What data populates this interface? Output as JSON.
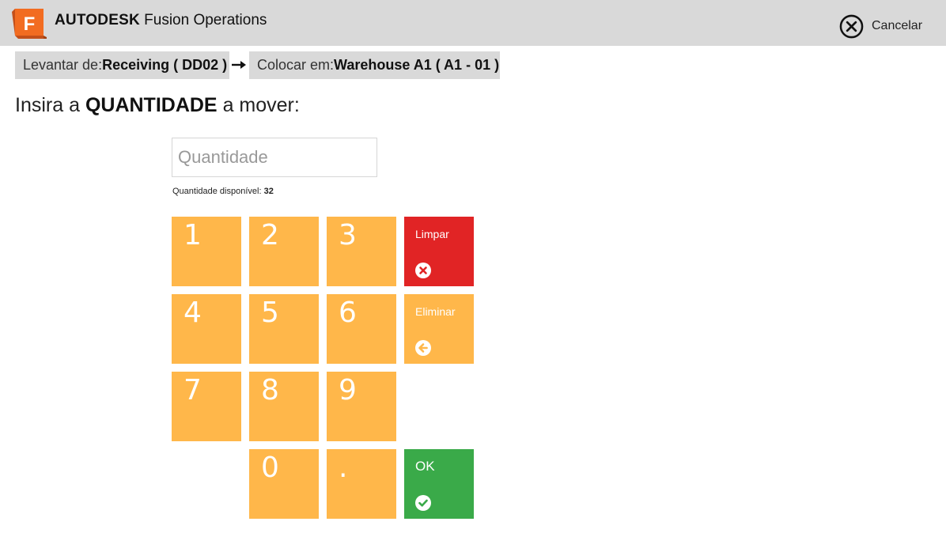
{
  "header": {
    "logo_letter": "F",
    "brand_bold": "AUTODESK",
    "brand_product": "Fusion Operations",
    "cancel_label": "Cancelar",
    "colors": {
      "bar": "#d9d9d9",
      "logo": "#f26c21"
    }
  },
  "route": {
    "from_label": "Levantar de:",
    "from_value": "Receiving ( DD02 )",
    "to_label": "Colocar em:",
    "to_value": "Warehouse A1 ( A1 - 01 )"
  },
  "prompt": {
    "prefix": "Insira a",
    "emphasis": "QUANTIDADE",
    "suffix": "a mover:"
  },
  "quantity": {
    "placeholder": "Quantidade",
    "value": "",
    "available_label": "Quantidade disponível:",
    "available_value": "32"
  },
  "keypad": {
    "digits": [
      "1",
      "2",
      "3",
      "4",
      "5",
      "6",
      "7",
      "8",
      "9",
      "0",
      "."
    ],
    "clear_label": "Limpar",
    "delete_label": "Eliminar",
    "ok_label": "OK",
    "colors": {
      "key": "#ffb74a",
      "clear": "#e12425",
      "ok": "#3aaa49"
    }
  },
  "icons": {
    "cancel": "close-circle-icon",
    "arrow": "arrow-right-icon",
    "clear": "x-circle-icon",
    "delete": "arrow-left-circle-icon",
    "ok": "check-circle-icon"
  }
}
